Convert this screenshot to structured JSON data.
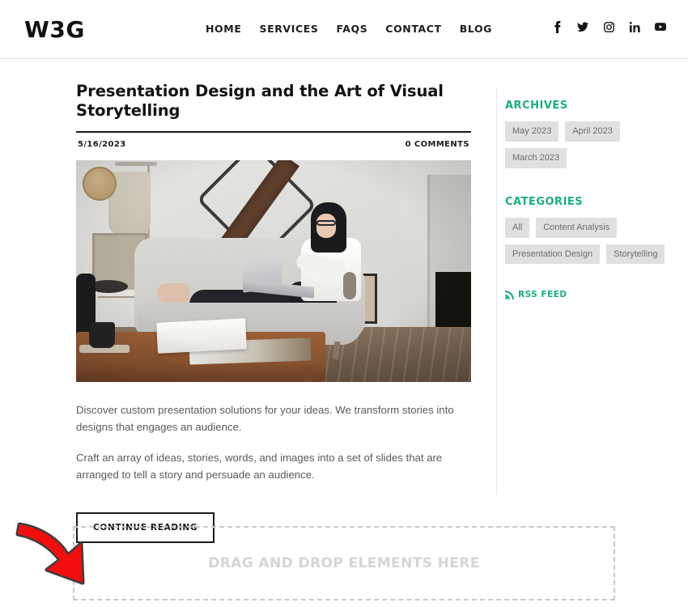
{
  "header": {
    "logo": "W3G",
    "nav": [
      {
        "label": "HOME",
        "name": "nav-home"
      },
      {
        "label": "SERVICES",
        "name": "nav-services"
      },
      {
        "label": "FAQS",
        "name": "nav-faqs"
      },
      {
        "label": "CONTACT",
        "name": "nav-contact"
      },
      {
        "label": "BLOG",
        "name": "nav-blog"
      }
    ],
    "social": [
      {
        "icon": "facebook-icon"
      },
      {
        "icon": "twitter-icon"
      },
      {
        "icon": "instagram-icon"
      },
      {
        "icon": "linkedin-icon"
      },
      {
        "icon": "youtube-icon"
      }
    ]
  },
  "article": {
    "title": "Presentation Design and the Art of Visual Storytelling",
    "date": "5/16/2023",
    "comments": "0 COMMENTS",
    "image_alt": "woman sitting on a gray sofa using a laptop in a living room",
    "paragraph_1": "Discover custom presentation solutions for your ideas. We transform stories into designs that engages an audience.",
    "paragraph_2": "Craft an array of ideas, stories, words, and images into a set of slides that are arranged to tell a story and persuade an audience.",
    "continue_label": "CONTINUE READING"
  },
  "sidebar": {
    "archives_heading": "ARCHIVES",
    "archives": [
      {
        "label": "May 2023"
      },
      {
        "label": "April 2023"
      },
      {
        "label": "March 2023"
      }
    ],
    "categories_heading": "CATEGORIES",
    "categories": [
      {
        "label": "All"
      },
      {
        "label": "Content Analysis"
      },
      {
        "label": "Presentation Design"
      },
      {
        "label": "Storytelling"
      }
    ],
    "rss_label": "RSS FEED",
    "rss_icon": "rss-icon"
  },
  "dropzone": {
    "label": "DRAG AND DROP ELEMENTS HERE"
  },
  "colors": {
    "accent_green": "#19b077",
    "tag_bg": "#e0e0e0",
    "tag_text": "#6d6d6d",
    "body_text": "#5a5a5a",
    "heading_text": "#131313",
    "dropzone_border": "#c8c8c8",
    "dropzone_text": "#d5d5d5",
    "cursor_arrow": "#f40d0d"
  }
}
